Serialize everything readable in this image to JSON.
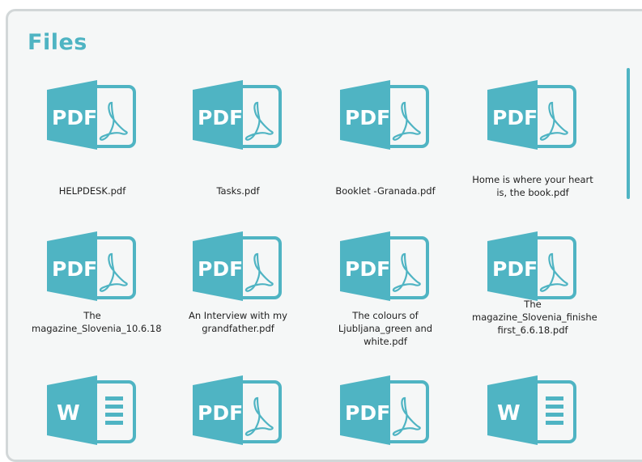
{
  "title": "Files",
  "colors": {
    "accent": "#4fb4c3",
    "background": "#f5f7f7",
    "border": "#d2d7d8"
  },
  "pdf_label": "PDF",
  "word_label": "W",
  "files": [
    {
      "name": "HELPDESK.pdf",
      "icon": "pdf-icon"
    },
    {
      "name": "Tasks.pdf",
      "icon": "pdf-icon"
    },
    {
      "name": "Booklet -Granada.pdf",
      "icon": "pdf-icon"
    },
    {
      "name": "Home is where your heart is, the book.pdf",
      "icon": "pdf-icon"
    },
    {
      "name": "The magazine_Slovenia_10.6.18",
      "icon": "pdf-icon"
    },
    {
      "name": "An Interview with my grandfather.pdf",
      "icon": "pdf-icon"
    },
    {
      "name": "The colours of Ljubljana_green and white.pdf",
      "icon": "pdf-icon"
    },
    {
      "name": "The magazine_Slovenia_finishe first_6.6.18.pdf",
      "icon": "pdf-icon"
    },
    {
      "name": "",
      "icon": "word-icon"
    },
    {
      "name": "",
      "icon": "pdf-icon"
    },
    {
      "name": "",
      "icon": "pdf-icon"
    },
    {
      "name": "",
      "icon": "word-icon"
    }
  ]
}
